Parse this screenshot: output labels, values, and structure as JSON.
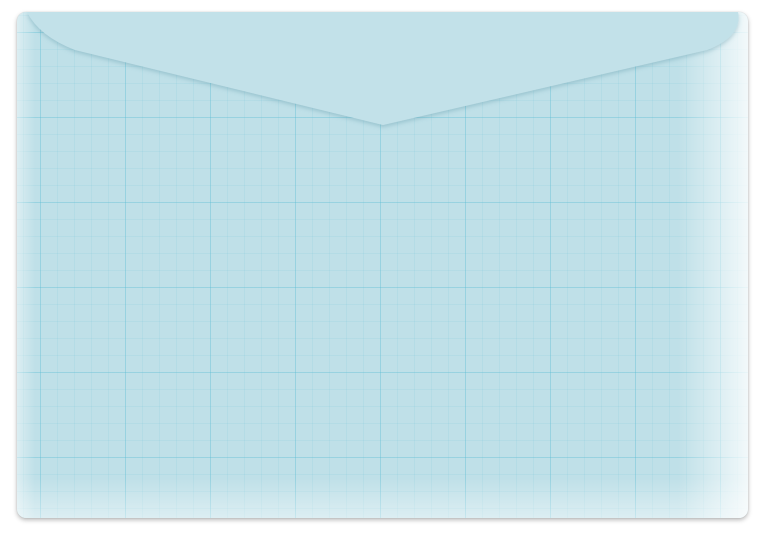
{
  "envelope": {
    "paper_color": "#bfe0e8",
    "grid_color": "#50b9d2",
    "flap_color": "#c2e1e9",
    "pattern": "graph-paper-grid"
  }
}
